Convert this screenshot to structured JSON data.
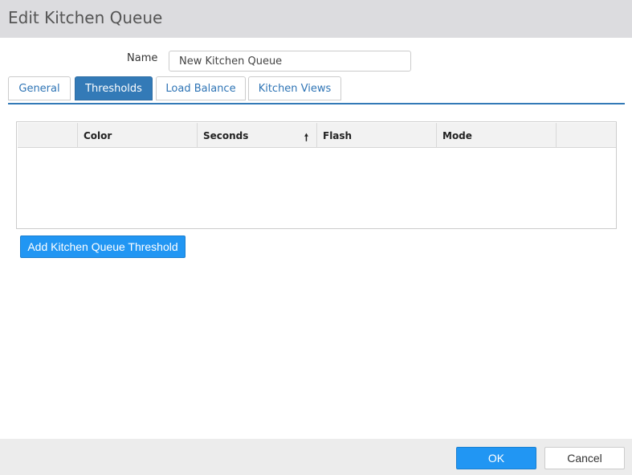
{
  "dialog": {
    "title": "Edit Kitchen Queue"
  },
  "form": {
    "name_label": "Name",
    "name_value": "New Kitchen Queue"
  },
  "tabs": [
    {
      "label": "General",
      "active": false
    },
    {
      "label": "Thresholds",
      "active": true
    },
    {
      "label": "Load Balance",
      "active": false
    },
    {
      "label": "Kitchen Views",
      "active": false
    }
  ],
  "grid": {
    "columns": [
      "",
      "Color",
      "Seconds",
      "Flash",
      "Mode",
      ""
    ],
    "sort_column": "Seconds",
    "sort_icon": "sort-ascending-icon",
    "sort_glyph": "🠕",
    "rows": []
  },
  "actions": {
    "add_threshold_label": "Add Kitchen Queue Threshold"
  },
  "footer": {
    "ok_label": "OK",
    "cancel_label": "Cancel"
  },
  "colors": {
    "accent": "#337ab7",
    "button_primary": "#2196f3",
    "title_bar": "#dcdcdf",
    "footer_bar": "#ececec"
  }
}
